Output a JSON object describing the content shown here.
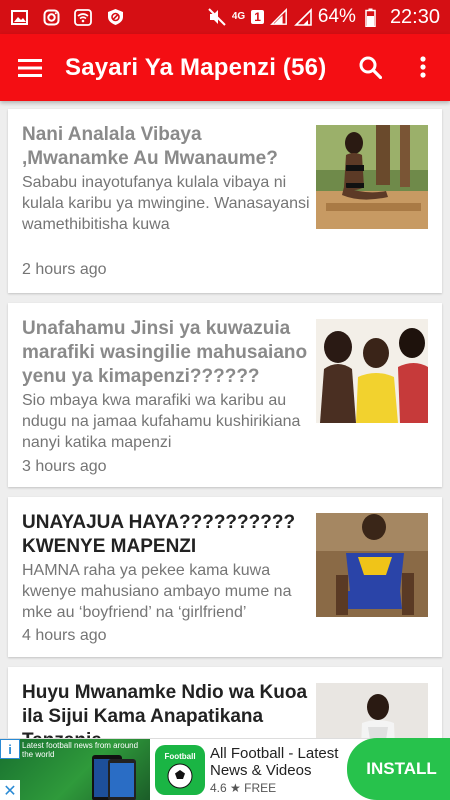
{
  "colors": {
    "primary": "#f40e13",
    "status_bar": "#d50f14",
    "install": "#27c24c"
  },
  "status_bar": {
    "left_icons": [
      "gallery-icon",
      "instagram-icon",
      "wifi-app-icon",
      "vpn-icon"
    ],
    "network": "4G",
    "sim": "1",
    "battery_pct": "64%",
    "time": "22:30"
  },
  "app_bar": {
    "title": "Sayari Ya Mapenzi (56)",
    "icons": [
      "menu-icon",
      "search-icon",
      "more-vertical-icon"
    ]
  },
  "articles": [
    {
      "title": "Nani Analala Vibaya ,Mwanamke Au Mwanaume?",
      "snippet": "Sababu inayotufanya kulala vibaya ni kulala karibu ya mwingine. Wanasayansi wamethibitisha  kuwa",
      "time": "2 hours ago",
      "read": true
    },
    {
      "title": "Unafahamu Jinsi ya kuwazuia marafiki wasingilie mahusaiano yenu ya kimapenzi??????",
      "snippet": "Sio mbaya kwa marafiki wa karibu au ndugu na jamaa kufahamu kushirikiana nanyi katika mapenzi",
      "time": "3 hours ago",
      "read": true
    },
    {
      "title": "UNAYAJUA HAYA?????????? KWENYE MAPENZI",
      "snippet": "HAMNA raha ya pekee kama kuwa kwenye mahusiano ambayo mume na mke au ‘boyfriend’ na ‘girlfriend’",
      "time": "4 hours ago",
      "read": false
    },
    {
      "title": "Huyu Mwanamke Ndio wa Kuoa ila Sijui Kama Anapatikana Tanzania",
      "snippet": "",
      "time": "",
      "read": false
    }
  ],
  "ad": {
    "banner_text": "Latest football news from around the world",
    "app_icon_label": "Football",
    "title": "All Football - Latest News & Videos",
    "rating": "4.6",
    "price": "FREE",
    "install_label": "INSTALL"
  }
}
